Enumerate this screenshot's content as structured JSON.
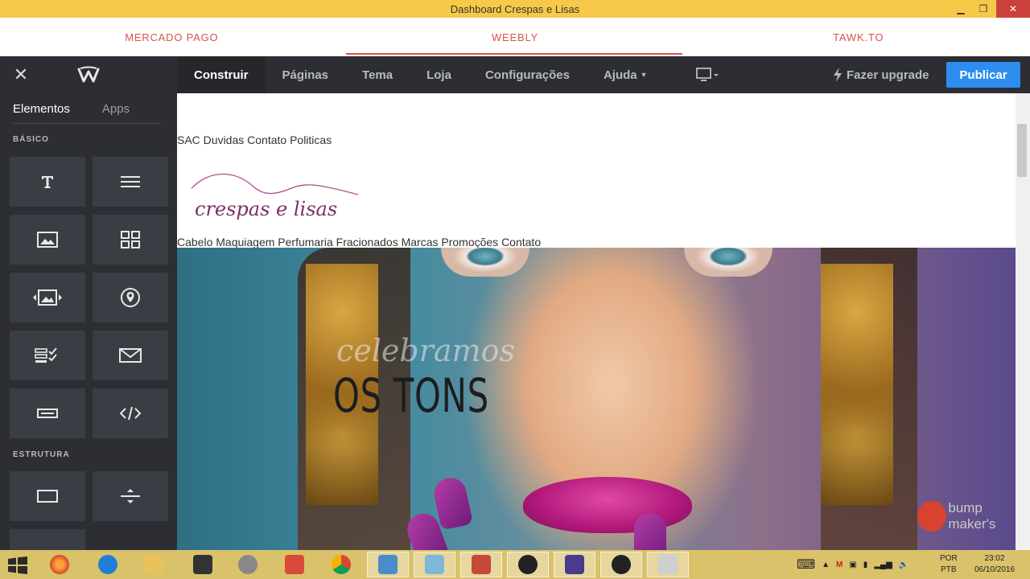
{
  "window": {
    "title": "Dashboard Crespas e Lisas"
  },
  "browser_tabs": [
    {
      "label": "MERCADO PAGO"
    },
    {
      "label": "WEEBLY"
    },
    {
      "label": "TAWK.TO"
    }
  ],
  "topnav": {
    "links": [
      {
        "label": "Construir",
        "active": true
      },
      {
        "label": "Páginas"
      },
      {
        "label": "Tema"
      },
      {
        "label": "Loja"
      },
      {
        "label": "Configurações"
      },
      {
        "label": "Ajuda"
      }
    ],
    "upgrade_label": "Fazer upgrade",
    "publish_label": "Publicar"
  },
  "sidebar": {
    "tabs": [
      {
        "label": "Elementos"
      },
      {
        "label": "Apps"
      }
    ],
    "sections": [
      {
        "label": "BÁSICO"
      },
      {
        "label": "ESTRUTURA"
      }
    ],
    "basic_tiles": [
      {
        "icon": "title-icon"
      },
      {
        "icon": "text-icon"
      },
      {
        "icon": "image-icon"
      },
      {
        "icon": "gallery-icon"
      },
      {
        "icon": "slideshow-icon"
      },
      {
        "icon": "map-icon"
      },
      {
        "icon": "contact-form-icon"
      },
      {
        "icon": "newsletter-icon"
      },
      {
        "icon": "button-icon"
      },
      {
        "icon": "embed-code-icon"
      }
    ],
    "structure_tiles": [
      {
        "icon": "section-icon"
      },
      {
        "icon": "divider-icon"
      }
    ]
  },
  "site": {
    "top_menu": "SAC Duvidas Contato Politicas",
    "logo_text": "crespas e lisas",
    "main_menu": "Cabelo Maquiagem Perfumaria Fracionados Marcas Promoções Contato",
    "hero": {
      "subtitle": "celebramos",
      "headline": "OS TONS"
    }
  },
  "watermark": "bump maker's",
  "taskbar": {
    "language": [
      "POR",
      "PTB"
    ],
    "time": "23:02",
    "date": "06/10/2016"
  },
  "colors": {
    "accent": "#2d8ef0",
    "tab_text": "#d9534f",
    "nav_bg": "#2c2e33",
    "title_bar": "#f7c948",
    "taskbar": "#d9c26a"
  }
}
